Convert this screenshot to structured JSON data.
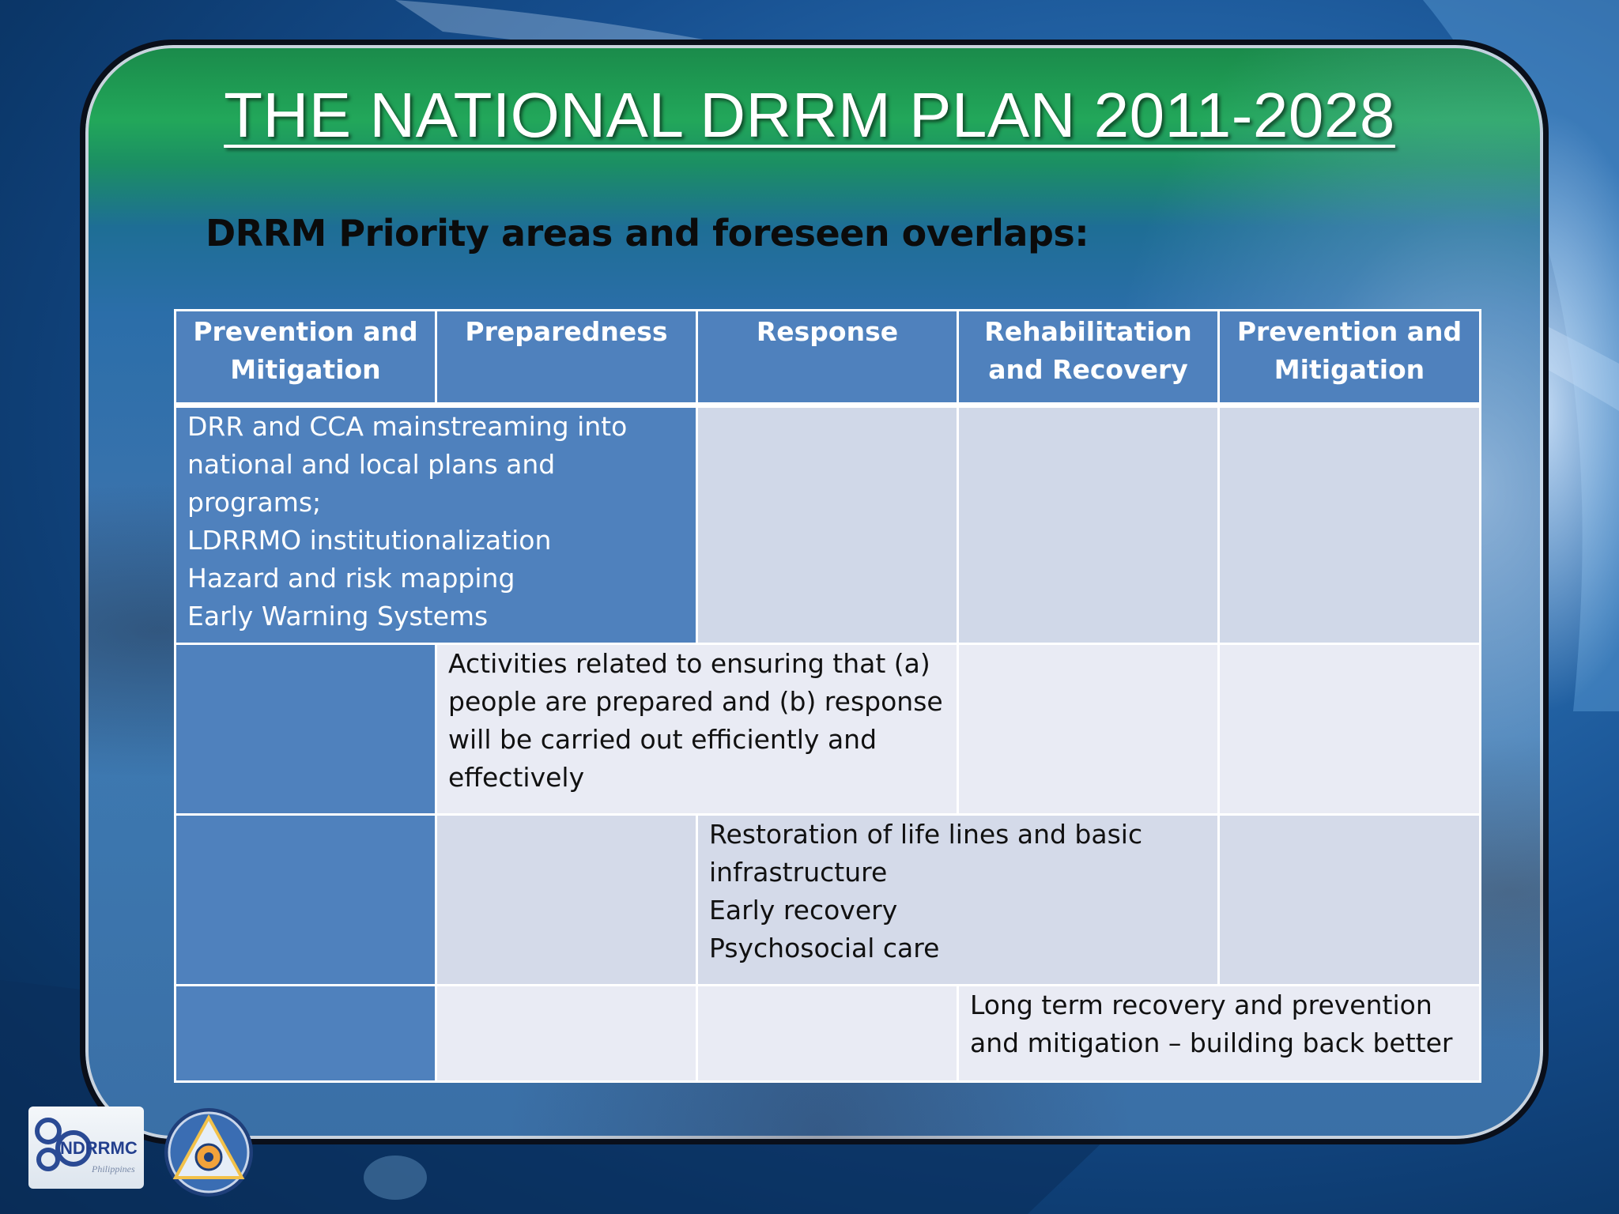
{
  "slide": {
    "title": "THE NATIONAL DRRM PLAN 2011-2028",
    "subtitle": "DRRM Priority areas and foreseen overlaps:"
  },
  "table": {
    "headers": [
      "Prevention and Mitigation",
      "Preparedness",
      "Response",
      "Rehabilitation and Recovery",
      "Prevention and Mitigation"
    ],
    "rows": [
      {
        "text": "DRR and CCA mainstreaming into\nnational and local plans and programs;\nLDRRMO institutionalization\nHazard and risk mapping\nEarly Warning Systems"
      },
      {
        "text": "Activities related to ensuring that (a)\npeople are prepared and (b) response\nwill be carried out efficiently and\neffectively"
      },
      {
        "text": "Restoration of life lines and basic\ninfrastructure\nEarly recovery\nPsychosocial care"
      },
      {
        "text": "Long term recovery and prevention\nand mitigation – building back better"
      }
    ]
  },
  "logos": {
    "ndrrmc_text": "NDRRMC",
    "ndrrmc_subtext": "Philippines"
  },
  "colors": {
    "header_blue": "#4f81bd",
    "cell_light_1": "#d0d8e8",
    "cell_light_2": "#e9ebf4",
    "title_text": "#ffffff",
    "subtitle_text": "#0b0b0b"
  }
}
